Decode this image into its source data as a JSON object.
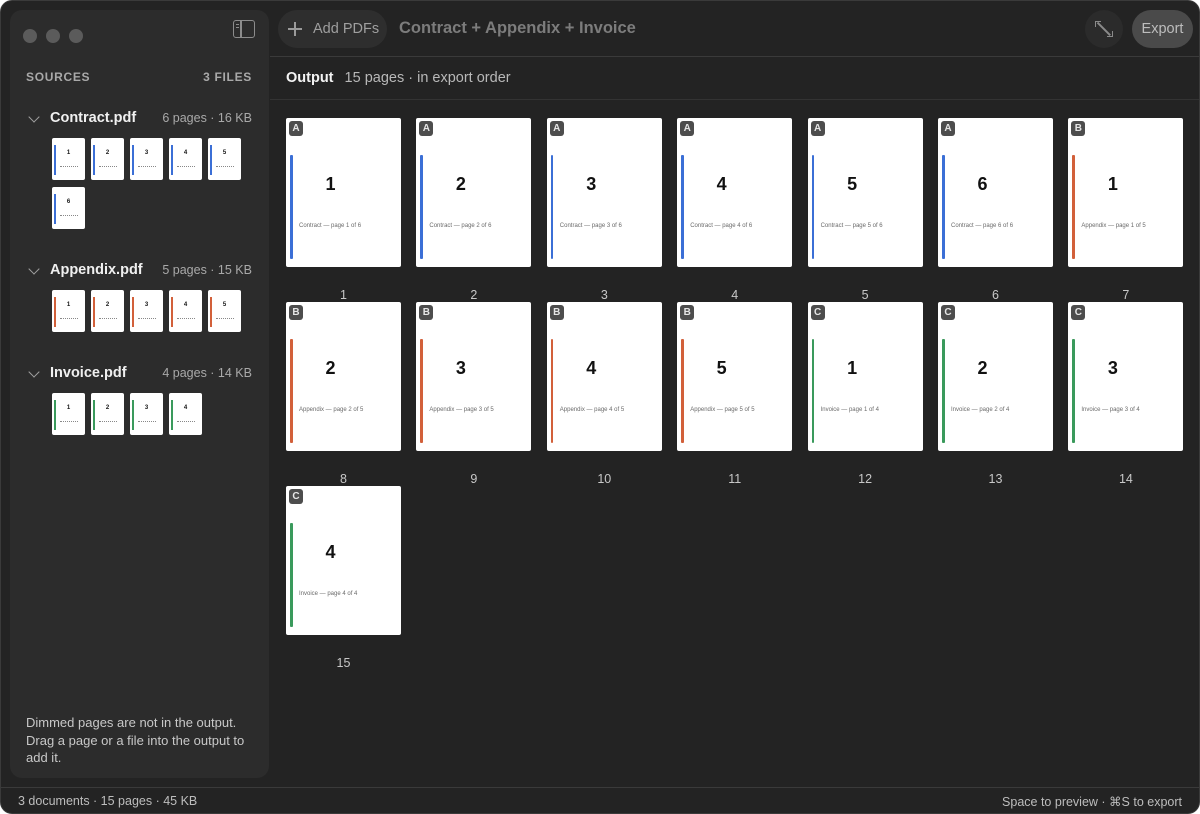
{
  "window": {
    "title": "Contract + Appendix + Invoice"
  },
  "toolbar": {
    "add_label": "Add PDFs",
    "export_label": "Export"
  },
  "sidebar": {
    "heading": "SOURCES",
    "file_count": "3 FILES",
    "files": [
      {
        "name": "Contract.pdf",
        "meta": "6 pages · 16 KB",
        "color": "#3b6fd6",
        "pages": [
          "1",
          "2",
          "3",
          "4",
          "5",
          "6"
        ]
      },
      {
        "name": "Appendix.pdf",
        "meta": "5 pages · 15 KB",
        "color": "#d2603a",
        "pages": [
          "1",
          "2",
          "3",
          "4",
          "5"
        ]
      },
      {
        "name": "Invoice.pdf",
        "meta": "4 pages · 14 KB",
        "color": "#3a9a5c",
        "pages": [
          "1",
          "2",
          "3",
          "4"
        ]
      }
    ],
    "help": "Dimmed pages are not in the output. Drag a page or a file into the output to add it."
  },
  "output": {
    "title": "Output",
    "subtitle": "15 pages · in export order",
    "pages": [
      {
        "badge": "A",
        "num": "1",
        "caption": "Contract — page 1 of 6",
        "order": "1"
      },
      {
        "badge": "A",
        "num": "2",
        "caption": "Contract — page 2 of 6",
        "order": "2"
      },
      {
        "badge": "A",
        "num": "3",
        "caption": "Contract — page 3 of 6",
        "order": "3"
      },
      {
        "badge": "A",
        "num": "4",
        "caption": "Contract — page 4 of 6",
        "order": "4"
      },
      {
        "badge": "A",
        "num": "5",
        "caption": "Contract — page 5 of 6",
        "order": "5"
      },
      {
        "badge": "A",
        "num": "6",
        "caption": "Contract — page 6 of 6",
        "order": "6"
      },
      {
        "badge": "B",
        "num": "1",
        "caption": "Appendix — page 1 of 5",
        "order": "7"
      },
      {
        "badge": "B",
        "num": "2",
        "caption": "Appendix — page 2 of 5",
        "order": "8"
      },
      {
        "badge": "B",
        "num": "3",
        "caption": "Appendix — page 3 of 5",
        "order": "9"
      },
      {
        "badge": "B",
        "num": "4",
        "caption": "Appendix — page 4 of 5",
        "order": "10"
      },
      {
        "badge": "B",
        "num": "5",
        "caption": "Appendix — page 5 of 5",
        "order": "11"
      },
      {
        "badge": "C",
        "num": "1",
        "caption": "Invoice — page 1 of 4",
        "order": "12"
      },
      {
        "badge": "C",
        "num": "2",
        "caption": "Invoice — page 2 of 4",
        "order": "13"
      },
      {
        "badge": "C",
        "num": "3",
        "caption": "Invoice — page 3 of 4",
        "order": "14"
      },
      {
        "badge": "C",
        "num": "4",
        "caption": "Invoice — page 4 of 4",
        "order": "15"
      }
    ]
  },
  "badge_colors": {
    "A": "#3b6fd6",
    "B": "#d2603a",
    "C": "#3a9a5c"
  },
  "status": {
    "left": "3 documents · 15 pages · 45 KB",
    "right": "Space to preview · ⌘S to export"
  }
}
